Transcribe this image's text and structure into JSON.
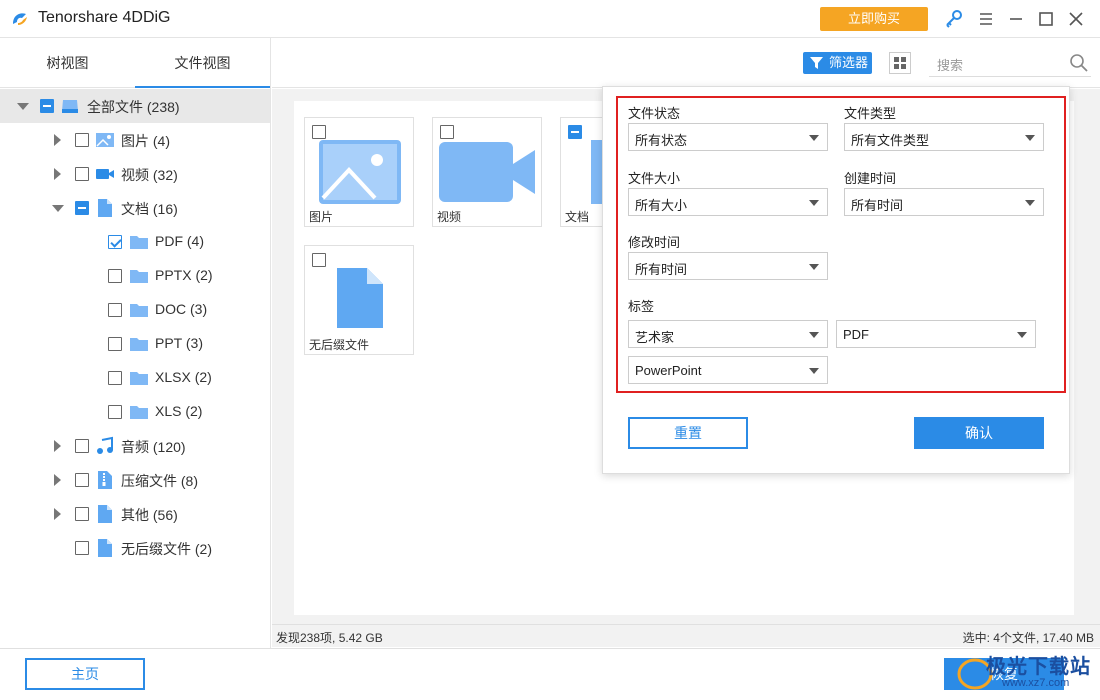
{
  "app": {
    "title": "Tenorshare 4DDiG",
    "buy_label": "立即购买"
  },
  "left": {
    "tabs": [
      {
        "label": "树视图"
      },
      {
        "label": "文件视图"
      }
    ],
    "tree": [
      {
        "label": "全部文件 (238)"
      },
      {
        "label": "图片 (4)"
      },
      {
        "label": "视频 (32)"
      },
      {
        "label": "文档 (16)"
      },
      {
        "label": "PDF (4)"
      },
      {
        "label": "PPTX (2)"
      },
      {
        "label": "DOC (3)"
      },
      {
        "label": "PPT (3)"
      },
      {
        "label": "XLSX (2)"
      },
      {
        "label": "XLS (2)"
      },
      {
        "label": "音频 (120)"
      },
      {
        "label": "压缩文件 (8)"
      },
      {
        "label": "其他 (56)"
      },
      {
        "label": "无后缀文件 (2)"
      }
    ]
  },
  "toolbar": {
    "filter_label": "筛选器",
    "search_placeholder": "搜索"
  },
  "cards": [
    {
      "label": "图片"
    },
    {
      "label": "视频"
    },
    {
      "label": "文档"
    },
    {
      "label": "无后缀文件"
    }
  ],
  "status": {
    "left": "发现238项, 5.42 GB",
    "right": "选中: 4个文件, 17.40 MB"
  },
  "bottom": {
    "home_label": "主页",
    "recover_label": "恢复"
  },
  "watermark": {
    "text": "极光下载站",
    "url": "www.xz7.com"
  },
  "filter": {
    "file_status": {
      "label": "文件状态",
      "value": "所有状态"
    },
    "file_type": {
      "label": "文件类型",
      "value": "所有文件类型"
    },
    "file_size": {
      "label": "文件大小",
      "value": "所有大小"
    },
    "created": {
      "label": "创建时间",
      "value": "所有时间"
    },
    "modified": {
      "label": "修改时间",
      "value": "所有时间"
    },
    "tags": {
      "label": "标签",
      "values": [
        "艺术家",
        "PDF",
        "PowerPoint"
      ]
    },
    "reset_label": "重置",
    "confirm_label": "确认"
  },
  "colors": {
    "accent": "#2b8be6",
    "buy": "#f5a523",
    "highlight": "#e02020"
  }
}
